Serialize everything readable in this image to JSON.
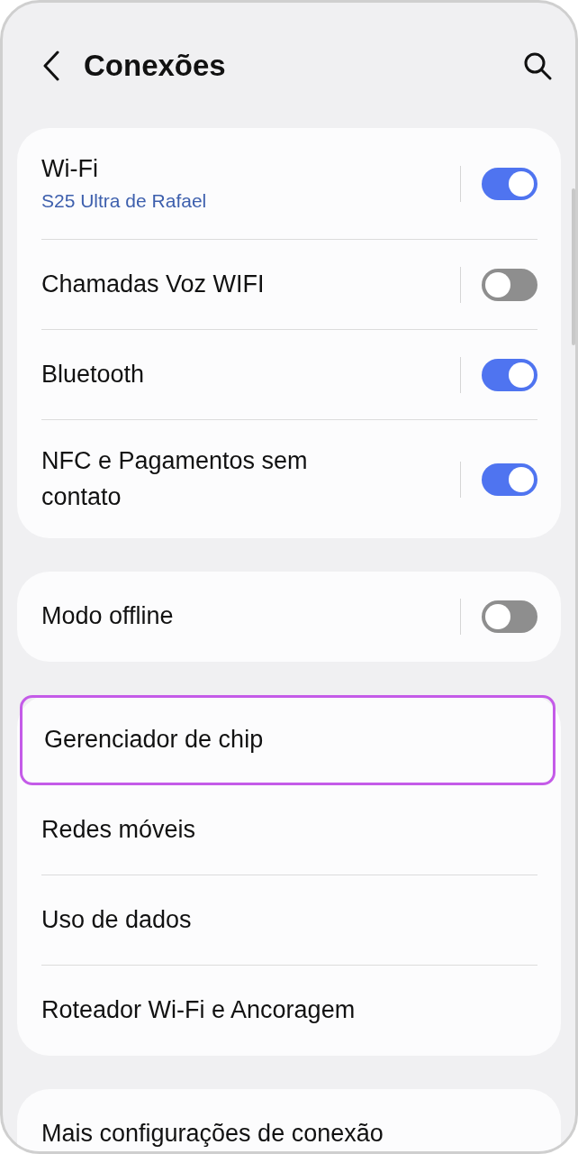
{
  "header": {
    "title": "Conexões"
  },
  "groups": [
    {
      "items": [
        {
          "label": "Wi-Fi",
          "subtitle": "S25 Ultra de Rafael",
          "kind": "toggle",
          "on": true
        },
        {
          "label": "Chamadas Voz WIFI",
          "kind": "toggle",
          "on": false
        },
        {
          "label": "Bluetooth",
          "kind": "toggle",
          "on": true
        },
        {
          "label": "NFC e Pagamentos sem contato",
          "kind": "toggle",
          "on": true
        }
      ]
    },
    {
      "items": [
        {
          "label": "Modo offline",
          "kind": "toggle",
          "on": false
        }
      ]
    },
    {
      "items": [
        {
          "label": "Gerenciador de chip",
          "kind": "link",
          "highlighted": true
        },
        {
          "label": "Redes móveis",
          "kind": "link",
          "highlighted": false
        },
        {
          "label": "Uso de dados",
          "kind": "link",
          "highlighted": false
        },
        {
          "label": "Roteador Wi-Fi e Ancoragem",
          "kind": "link",
          "highlighted": false
        }
      ]
    },
    {
      "items": [
        {
          "label": "Mais configurações de conexão",
          "kind": "link",
          "highlighted": false
        }
      ]
    }
  ]
}
